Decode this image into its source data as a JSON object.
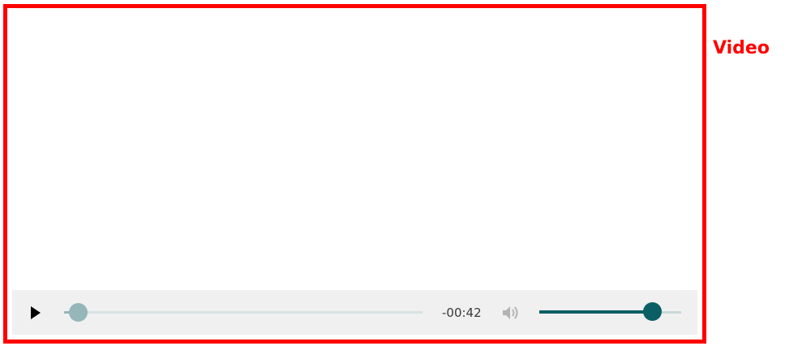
{
  "label": "Video",
  "player": {
    "play_icon": "play-icon",
    "time_remaining": "-00:42",
    "volume_icon": "volume-icon",
    "progress": 0.03,
    "volume": 0.8
  },
  "colors": {
    "frame_border": "#ff0000",
    "label": "#ff0000",
    "control_bar_bg": "#f0f0f0",
    "seek_track": "#d8e2e2",
    "seek_thumb": "#96b7ba",
    "volume_fill": "#0b5f64",
    "volume_track": "#c9d8d9"
  }
}
